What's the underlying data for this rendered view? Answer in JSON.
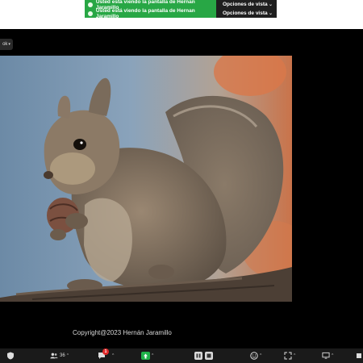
{
  "banner": {
    "text1": "Usted está viendo la pantalla de Hernan Jaramillo",
    "text2": "Usted está viendo la pantalla de Hernan Jaramillo",
    "color": "#28a745"
  },
  "view_options": {
    "label1": "Opciones de vista",
    "label2": "Opciones de vista"
  },
  "stage": {
    "mini_label": "ok"
  },
  "slide": {
    "copyright": "Copyright@2023 Hernán Jaramillo"
  },
  "toolbar": {
    "participants_count": "36",
    "chat_badge": "1"
  }
}
